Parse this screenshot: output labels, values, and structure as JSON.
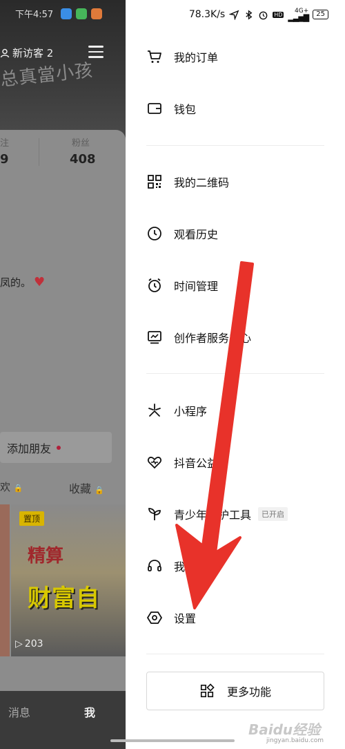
{
  "left": {
    "status_time": "下午4:57",
    "hero_text": "总真當小孩",
    "visitors": "新访客 2",
    "stats": [
      {
        "label": "注",
        "value": "9"
      },
      {
        "label": "粉丝",
        "value": "408"
      }
    ],
    "bio": "凤的。",
    "add_friend": "添加朋友",
    "tab_likes": "欢",
    "tab_favorites": "收藏",
    "pinned": "置顶",
    "thumb_top": "精算",
    "thumb_title": "财富自",
    "views": "203",
    "nav_messages": "消息",
    "nav_me": "我"
  },
  "status": {
    "network_speed": "78.3K/s",
    "signal": "4G+",
    "battery": "25",
    "hd": "HD"
  },
  "drawer": {
    "group1": [
      {
        "label": "我的订单",
        "icon": "cart-icon"
      },
      {
        "label": "钱包",
        "icon": "wallet-icon"
      }
    ],
    "group2": [
      {
        "label": "我的二维码",
        "icon": "qrcode-icon"
      },
      {
        "label": "观看历史",
        "icon": "clock-icon"
      },
      {
        "label": "时间管理",
        "icon": "alarm-icon"
      },
      {
        "label": "创作者服务中心",
        "icon": "creator-icon"
      }
    ],
    "group3": [
      {
        "label": "小程序",
        "icon": "miniapp-icon"
      },
      {
        "label": "抖音公益",
        "icon": "charity-icon"
      },
      {
        "label": "青少年守护工具",
        "icon": "sprout-icon",
        "badge": "已开启"
      },
      {
        "label": "我的客服",
        "icon": "headset-icon"
      },
      {
        "label": "设置",
        "icon": "settings-icon"
      }
    ],
    "more_button": "更多功能"
  },
  "watermark": {
    "brand": "Baidu经验",
    "url": "jingyan.baidu.com"
  },
  "annotation": {
    "arrow_color": "#e8322a"
  }
}
